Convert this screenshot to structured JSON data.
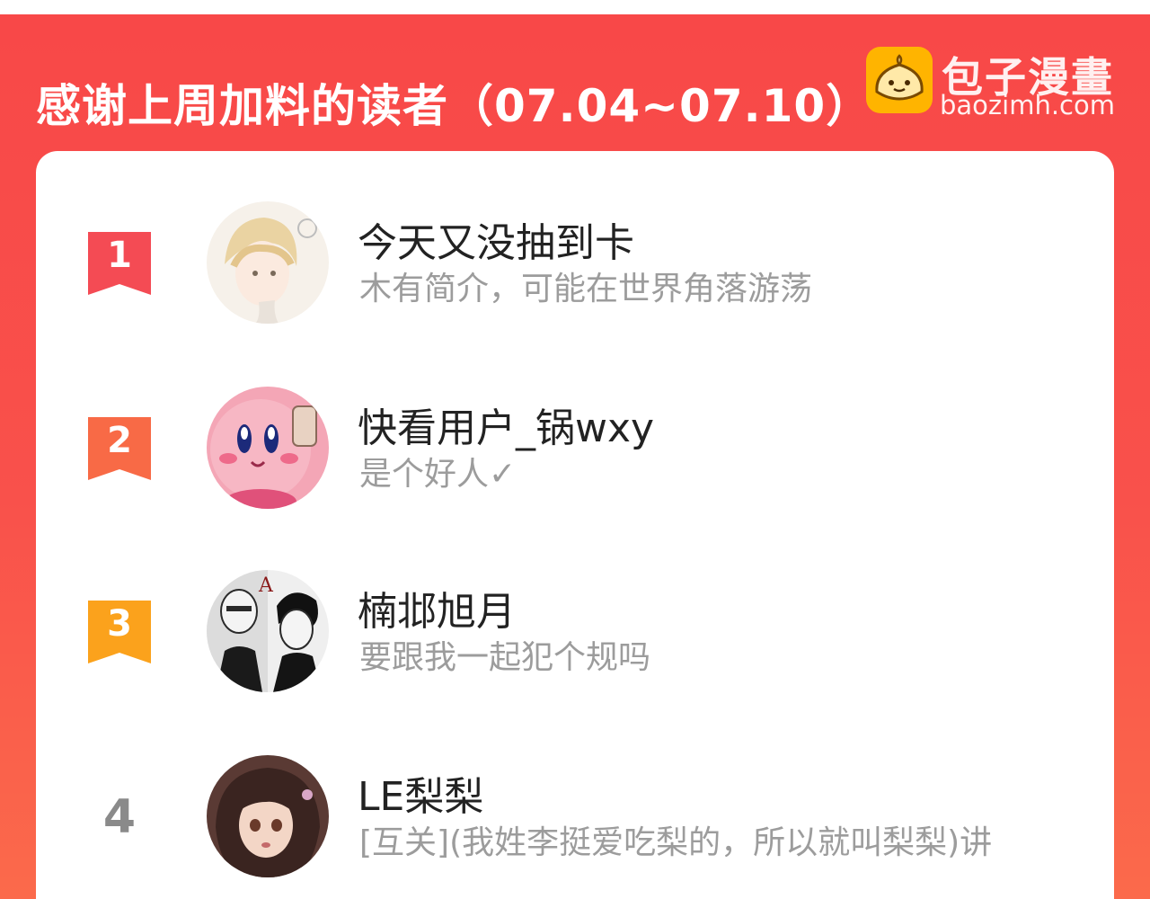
{
  "header": {
    "title": "感谢上周加料的读者（07.04~07.10）"
  },
  "brand": {
    "name": "包子漫畫",
    "url": "baozimh.com",
    "logo_icon": "baozi-bun-icon",
    "logo_color": "#ffb400"
  },
  "readers": [
    {
      "rank": "1",
      "name": "今天又没抽到卡",
      "bio": "木有简介，可能在世界角落游荡",
      "badge_color": "#f44b54"
    },
    {
      "rank": "2",
      "name": "快看用户_锅wxy",
      "bio": "是个好人✓",
      "badge_color": "#f86a46"
    },
    {
      "rank": "3",
      "name": "楠邶旭月",
      "bio": "要跟我一起犯个规吗",
      "badge_color": "#fba21c"
    },
    {
      "rank": "4",
      "name": "LE梨梨",
      "bio": "[互关](我姓李挺爱吃梨的，所以就叫梨梨)讲",
      "badge_color": "#8a8a8a"
    }
  ],
  "colors": {
    "background": "#f84848",
    "card": "#ffffff"
  }
}
